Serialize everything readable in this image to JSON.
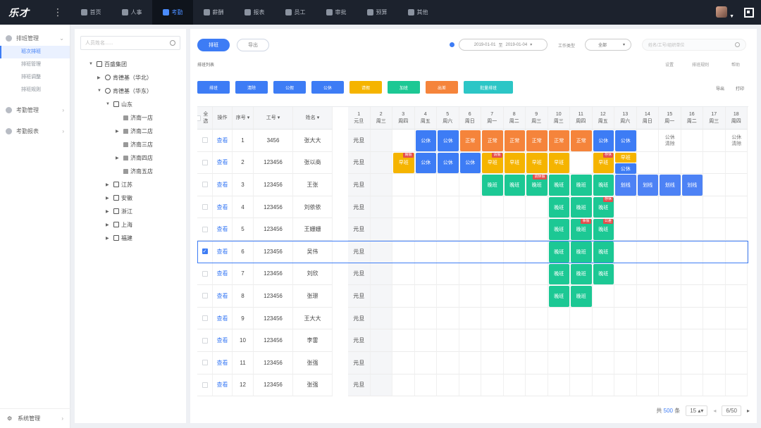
{
  "app": {
    "logo": "乐才"
  },
  "nav": {
    "tabs": [
      {
        "label": "首页",
        "icon": "home-icon"
      },
      {
        "label": "人事",
        "icon": "person-icon"
      },
      {
        "label": "考勤",
        "icon": "calendar-icon",
        "active": true
      },
      {
        "label": "薪酬",
        "icon": "wallet-icon"
      },
      {
        "label": "报表",
        "icon": "report-icon"
      },
      {
        "label": "员工",
        "icon": "employee-icon"
      },
      {
        "label": "审批",
        "icon": "approve-icon"
      },
      {
        "label": "预算",
        "icon": "budget-icon"
      },
      {
        "label": "其他",
        "icon": "more-icon"
      }
    ]
  },
  "sidebar": {
    "groups": [
      {
        "label": "排班管理",
        "items": [
          "班次排班",
          "排班管理",
          "排班调整",
          "排班规则"
        ]
      },
      {
        "label": "考勤管理",
        "items": []
      },
      {
        "label": "考勤报表",
        "items": []
      }
    ],
    "bottom": "系统管理"
  },
  "tree": {
    "placeholder": "人员姓名......",
    "nodes": [
      {
        "label": "百盛集团",
        "level": 0,
        "arrow": "▼",
        "icon": "building-icon"
      },
      {
        "label": "肯德基（华北）",
        "level": 1,
        "arrow": "▶",
        "icon": "globe-icon"
      },
      {
        "label": "肯德基（华东）",
        "level": 1,
        "arrow": "▼",
        "icon": "globe-icon"
      },
      {
        "label": "山东",
        "level": 2,
        "arrow": "▼",
        "icon": "city-icon"
      },
      {
        "label": "济南一店",
        "level": 3,
        "arrow": "",
        "icon": "store-icon"
      },
      {
        "label": "济南二店",
        "level": 3,
        "arrow": "▶",
        "icon": "store-icon"
      },
      {
        "label": "济南三店",
        "level": 3,
        "arrow": "",
        "icon": "store-icon"
      },
      {
        "label": "济南四店",
        "level": 3,
        "arrow": "▶",
        "icon": "store-icon"
      },
      {
        "label": "济南五店",
        "level": 3,
        "arrow": "",
        "icon": "store-icon"
      },
      {
        "label": "江苏",
        "level": 2,
        "arrow": "▶",
        "icon": "city-icon"
      },
      {
        "label": "安徽",
        "level": 2,
        "arrow": "▶",
        "icon": "city-icon"
      },
      {
        "label": "浙江",
        "level": 2,
        "arrow": "▶",
        "icon": "city-icon"
      },
      {
        "label": "上海",
        "level": 2,
        "arrow": "▶",
        "icon": "city-icon"
      },
      {
        "label": "福建",
        "level": 2,
        "arrow": "▶",
        "icon": "city-icon"
      }
    ]
  },
  "toolbar": {
    "tab_schedule": "排班",
    "tab_export": "导出",
    "date_start": "2019-01-01",
    "date_sep": "至",
    "date_end": "2019-01-04",
    "worktype_label": "工作类型",
    "worktype_value": "全部",
    "search_placeholder": "姓名/工号/组织单位",
    "section_title": "排班列表",
    "right_links": [
      "设置",
      "排班规则",
      "帮助"
    ],
    "actions": [
      {
        "label": "排班",
        "color": "#3d7cf5"
      },
      {
        "label": "清除",
        "color": "#3d7cf5"
      },
      {
        "label": "公假",
        "color": "#3d7cf5"
      },
      {
        "label": "公休",
        "color": "#3d7cf5"
      },
      {
        "label": "请假",
        "color": "#f5b400"
      },
      {
        "label": "加班",
        "color": "#1cc894"
      },
      {
        "label": "出差",
        "color": "#f5843b"
      },
      {
        "label": "批量排班",
        "color": "#2cc6c6"
      }
    ],
    "right_actions": [
      "导出",
      "打印"
    ]
  },
  "table": {
    "headers": {
      "select_all": "全选",
      "action": "操作",
      "seq": "序号",
      "emp_no": "工号",
      "name": "姓名"
    },
    "days": [
      {
        "d": "1",
        "w": "元旦"
      },
      {
        "d": "2",
        "w": "周三"
      },
      {
        "d": "3",
        "w": "周四"
      },
      {
        "d": "4",
        "w": "周五"
      },
      {
        "d": "5",
        "w": "周六"
      },
      {
        "d": "6",
        "w": "周日"
      },
      {
        "d": "7",
        "w": "周一"
      },
      {
        "d": "8",
        "w": "周二"
      },
      {
        "d": "9",
        "w": "周三"
      },
      {
        "d": "10",
        "w": "周三"
      },
      {
        "d": "11",
        "w": "周四"
      },
      {
        "d": "12",
        "w": "周五"
      },
      {
        "d": "13",
        "w": "周六"
      },
      {
        "d": "14",
        "w": "周日"
      },
      {
        "d": "15",
        "w": "周一"
      },
      {
        "d": "16",
        "w": "周二"
      },
      {
        "d": "17",
        "w": "周三"
      },
      {
        "d": "18",
        "w": "周四"
      }
    ],
    "action_label": "查看",
    "day1_value": "元旦",
    "rows": [
      {
        "seq": "1",
        "emp_no": "3456",
        "name": "张大大",
        "checked": false
      },
      {
        "seq": "2",
        "emp_no": "123456",
        "name": "张以商",
        "checked": false
      },
      {
        "seq": "3",
        "emp_no": "123456",
        "name": "王张",
        "checked": false
      },
      {
        "seq": "4",
        "emp_no": "123456",
        "name": "刘依依",
        "checked": false
      },
      {
        "seq": "5",
        "emp_no": "123456",
        "name": "王姗姗",
        "checked": false
      },
      {
        "seq": "6",
        "emp_no": "123456",
        "name": "吴伟",
        "checked": true
      },
      {
        "seq": "7",
        "emp_no": "123456",
        "name": "刘欣",
        "checked": false
      },
      {
        "seq": "8",
        "emp_no": "123456",
        "name": "张璟",
        "checked": false
      },
      {
        "seq": "9",
        "emp_no": "123456",
        "name": "王大大",
        "checked": false
      },
      {
        "seq": "10",
        "emp_no": "123456",
        "name": "李雷",
        "checked": false
      },
      {
        "seq": "11",
        "emp_no": "123456",
        "name": "张强",
        "checked": false
      },
      {
        "seq": "12",
        "emp_no": "123456",
        "name": "张强",
        "checked": false
      }
    ],
    "shifts": [
      {
        "row": 0,
        "col": 3,
        "label": "公休",
        "color": "#3d7cf5"
      },
      {
        "row": 0,
        "col": 4,
        "label": "公休",
        "color": "#3d7cf5"
      },
      {
        "row": 0,
        "col": 5,
        "label": "正常",
        "color": "#f5843b"
      },
      {
        "row": 0,
        "col": 6,
        "label": "正常",
        "color": "#f5843b"
      },
      {
        "row": 0,
        "col": 7,
        "label": "正常",
        "color": "#f5843b"
      },
      {
        "row": 0,
        "col": 8,
        "label": "正常",
        "color": "#f5843b"
      },
      {
        "row": 0,
        "col": 9,
        "label": "正常",
        "color": "#f5843b"
      },
      {
        "row": 0,
        "col": 10,
        "label": "正常",
        "color": "#f5843b"
      },
      {
        "row": 0,
        "col": 11,
        "label": "公休",
        "color": "#3d7cf5"
      },
      {
        "row": 0,
        "col": 12,
        "label": "公休",
        "color": "#3d7cf5"
      },
      {
        "row": 1,
        "col": 2,
        "label": "早班",
        "color": "#f5b400",
        "badge": "病假"
      },
      {
        "row": 1,
        "col": 3,
        "label": "公休",
        "color": "#3d7cf5"
      },
      {
        "row": 1,
        "col": 4,
        "label": "公休",
        "color": "#3d7cf5"
      },
      {
        "row": 1,
        "col": 5,
        "label": "公休",
        "color": "#3d7cf5"
      },
      {
        "row": 1,
        "col": 6,
        "label": "早班",
        "color": "#f5b400",
        "badge": "请假"
      },
      {
        "row": 1,
        "col": 7,
        "label": "早班",
        "color": "#f5b400"
      },
      {
        "row": 1,
        "col": 8,
        "label": "早班",
        "color": "#f5b400"
      },
      {
        "row": 1,
        "col": 9,
        "label": "早班",
        "color": "#f5b400"
      },
      {
        "row": 1,
        "col": 11,
        "label": "早班",
        "color": "#f5b400",
        "badge": "存休"
      },
      {
        "row": 2,
        "col": 6,
        "label": "晚班",
        "color": "#1cc894"
      },
      {
        "row": 2,
        "col": 7,
        "label": "晚班",
        "color": "#1cc894"
      },
      {
        "row": 2,
        "col": 8,
        "label": "晚班",
        "color": "#1cc894",
        "badge": "调休假"
      },
      {
        "row": 2,
        "col": 9,
        "label": "晚班",
        "color": "#1cc894"
      },
      {
        "row": 2,
        "col": 10,
        "label": "晚班",
        "color": "#1cc894"
      },
      {
        "row": 2,
        "col": 11,
        "label": "晚班",
        "color": "#1cc894"
      },
      {
        "row": 2,
        "col": 12,
        "label": "划线",
        "color": "#4d82f5"
      },
      {
        "row": 2,
        "col": 13,
        "label": "划线",
        "color": "#4d82f5"
      },
      {
        "row": 2,
        "col": 14,
        "label": "划线",
        "color": "#4d82f5"
      },
      {
        "row": 2,
        "col": 15,
        "label": "划线",
        "color": "#4d82f5"
      },
      {
        "row": 3,
        "col": 9,
        "label": "晚班",
        "color": "#1cc894"
      },
      {
        "row": 3,
        "col": 10,
        "label": "晚班",
        "color": "#1cc894"
      },
      {
        "row": 3,
        "col": 11,
        "label": "晚班",
        "color": "#1cc894",
        "badge": "存休"
      },
      {
        "row": 4,
        "col": 9,
        "label": "晚班",
        "color": "#1cc894"
      },
      {
        "row": 4,
        "col": 10,
        "label": "晚班",
        "color": "#1cc894",
        "badge": "事假"
      },
      {
        "row": 4,
        "col": 11,
        "label": "晚班",
        "color": "#1cc894",
        "badge": "公差"
      },
      {
        "row": 5,
        "col": 9,
        "label": "晚班",
        "color": "#1cc894"
      },
      {
        "row": 5,
        "col": 10,
        "label": "晚班",
        "color": "#1cc894"
      },
      {
        "row": 5,
        "col": 11,
        "label": "晚班",
        "color": "#1cc894"
      },
      {
        "row": 6,
        "col": 9,
        "label": "晚班",
        "color": "#1cc894"
      },
      {
        "row": 6,
        "col": 10,
        "label": "晚班",
        "color": "#1cc894"
      },
      {
        "row": 6,
        "col": 11,
        "label": "晚班",
        "color": "#1cc894"
      },
      {
        "row": 7,
        "col": 9,
        "label": "晚班",
        "color": "#1cc894"
      },
      {
        "row": 7,
        "col": 10,
        "label": "晚班",
        "color": "#1cc894"
      }
    ],
    "split_shift": {
      "row": 1,
      "col": 12,
      "top": {
        "label": "早班",
        "color": "#f5b400"
      },
      "bottom": {
        "label": "公休",
        "color": "#3d7cf5"
      }
    },
    "plain_notes": [
      {
        "row": 0,
        "col": 14,
        "text": "公休\n清除"
      },
      {
        "row": 0,
        "col": 17,
        "text": "公休\n清除"
      }
    ]
  },
  "pagination": {
    "total_prefix": "共",
    "total": "500",
    "total_suffix": "条",
    "page_size": "15",
    "current": "6/50"
  }
}
